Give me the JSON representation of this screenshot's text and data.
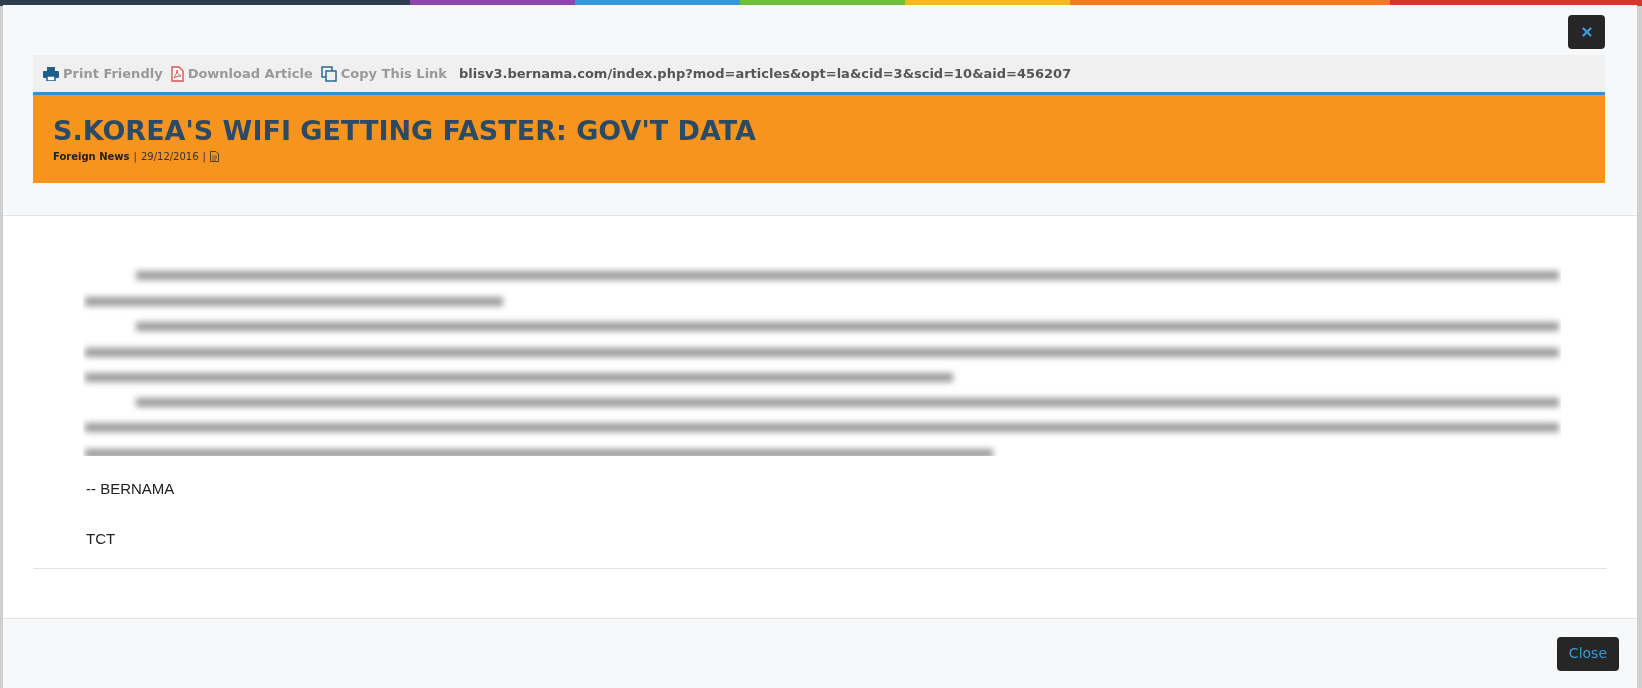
{
  "toolbar": {
    "actions": [
      {
        "kind": "print",
        "label": "Print Friendly"
      },
      {
        "kind": "pdf",
        "label": "Download Article"
      },
      {
        "kind": "copy",
        "label": "Copy This Link"
      }
    ],
    "url": "blisv3.bernama.com/index.php?mod=articles&opt=la&cid=3&scid=10&aid=456207"
  },
  "article": {
    "title": "S.KOREA'S WIFI GETTING FASTER: GOV'T DATA",
    "meta": [
      {
        "kind": "category",
        "text": "Foreign News"
      },
      {
        "kind": "separator",
        "text": "|"
      },
      {
        "kind": "date",
        "text": "29/12/2016"
      },
      {
        "kind": "separator",
        "text": "|"
      },
      {
        "kind": "document"
      }
    ],
    "signature": [
      "-- BERNAMA",
      "TCT"
    ]
  },
  "footer": {
    "button": "Close"
  }
}
